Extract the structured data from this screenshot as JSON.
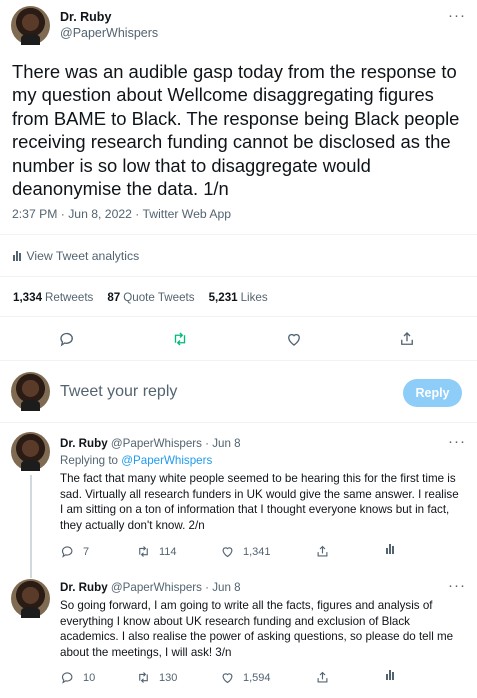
{
  "main_tweet": {
    "author_name": "Dr. Ruby",
    "author_handle": "@PaperWhispers",
    "text": "There was an audible gasp today from the response to my question about Wellcome disaggregating figures from BAME to Black.  The response being Black people receiving research funding cannot be disclosed as the number is so low that to disaggregate would deanonymise the data.  1/n",
    "meta": "2:37 PM · Jun 8, 2022 · Twitter Web App",
    "analytics_label": "View Tweet analytics",
    "retweets_count": "1,334",
    "retweets_label": "Retweets",
    "quotes_count": "87",
    "quotes_label": "Quote Tweets",
    "likes_count": "5,231",
    "likes_label": "Likes"
  },
  "reply_box": {
    "placeholder": "Tweet your reply",
    "button_label": "Reply"
  },
  "replies": [
    {
      "author_name": "Dr. Ruby",
      "author_handle": "@PaperWhispers",
      "date": "· Jun 8",
      "replying_label": "Replying to",
      "replying_to": "@PaperWhispers",
      "text": "The fact that many white people seemed to be hearing this for the first time is sad.  Virtually all research funders in UK would give the same answer. I realise I am sitting on a ton of information that I thought everyone knows but in fact, they actually don't know. 2/n",
      "reply_count": "7",
      "retweet_count": "114",
      "like_count": "1,341"
    },
    {
      "author_name": "Dr. Ruby",
      "author_handle": "@PaperWhispers",
      "date": "· Jun 8",
      "text": "So going forward, I am going to write all the facts, figures and analysis of everything I know about UK research funding and exclusion of Black academics. I also realise the power of asking questions, so please do tell me about the meetings, I will ask! 3/n",
      "reply_count": "10",
      "retweet_count": "130",
      "like_count": "1,594"
    }
  ],
  "colors": {
    "accent": "#1d9bf0",
    "retweet_green": "#00ba7c",
    "muted": "#536471",
    "reply_button_disabled": "#8ecdf8"
  }
}
